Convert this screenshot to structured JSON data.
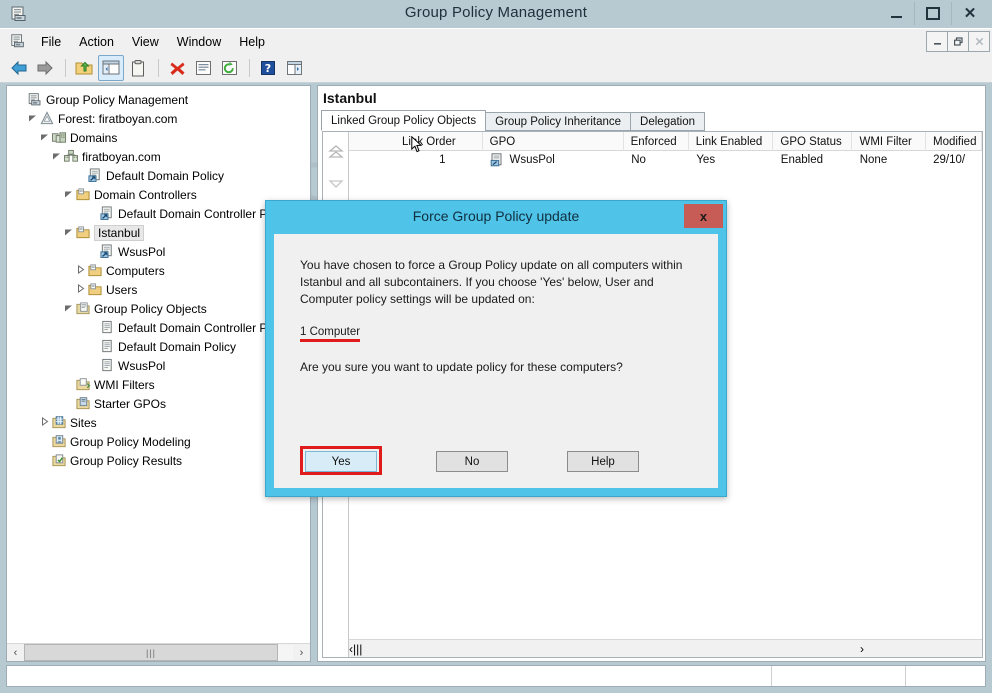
{
  "window": {
    "title": "Group Policy Management",
    "icon": "gpm-icon",
    "controls": {
      "minimize": "minimize-icon",
      "maximize": "maximize-icon",
      "close": "close-icon"
    }
  },
  "menu": {
    "items": [
      "File",
      "Action",
      "View",
      "Window",
      "Help"
    ],
    "mdi_controls": [
      "minimize",
      "restore",
      "close"
    ]
  },
  "toolbar": {
    "buttons": [
      {
        "name": "back-icon",
        "glyph": "back"
      },
      {
        "name": "forward-icon",
        "glyph": "forward"
      },
      {
        "name": "up-folder-icon",
        "glyph": "upfolder"
      },
      {
        "name": "show-hide-tree-icon",
        "glyph": "treepane",
        "selected": true
      },
      {
        "name": "properties-icon",
        "glyph": "clipboard"
      },
      {
        "name": "delete-icon",
        "glyph": "redx"
      },
      {
        "name": "report-icon",
        "glyph": "report"
      },
      {
        "name": "refresh-icon",
        "glyph": "refresh"
      },
      {
        "name": "help-icon",
        "glyph": "help"
      },
      {
        "name": "new-window-icon",
        "glyph": "newwindow"
      }
    ]
  },
  "tree": {
    "nodes": [
      {
        "label": "Group Policy Management",
        "indent": 0,
        "icon": "console-icon",
        "expander": ""
      },
      {
        "label": "Forest: firatboyan.com",
        "indent": 1,
        "icon": "forest-icon",
        "expander": "open"
      },
      {
        "label": "Domains",
        "indent": 2,
        "icon": "domains-icon",
        "expander": "open"
      },
      {
        "label": "firatboyan.com",
        "indent": 3,
        "icon": "domain-icon",
        "expander": "open"
      },
      {
        "label": "Default Domain Policy",
        "indent": 5,
        "icon": "gpo-link-icon",
        "expander": ""
      },
      {
        "label": "Domain Controllers",
        "indent": 4,
        "icon": "ou-icon",
        "expander": "open"
      },
      {
        "label": "Default Domain Controller Policy",
        "indent": 6,
        "icon": "gpo-link-icon",
        "expander": ""
      },
      {
        "label": "Istanbul",
        "indent": 4,
        "icon": "ou-icon",
        "expander": "open",
        "selected": true
      },
      {
        "label": "WsusPol",
        "indent": 6,
        "icon": "gpo-link-icon",
        "expander": ""
      },
      {
        "label": "Computers",
        "indent": 5,
        "icon": "ou-icon",
        "expander": "closed"
      },
      {
        "label": "Users",
        "indent": 5,
        "icon": "ou-icon",
        "expander": "closed"
      },
      {
        "label": "Group Policy Objects",
        "indent": 4,
        "icon": "gpo-container-icon",
        "expander": "open"
      },
      {
        "label": "Default Domain Controller Policy",
        "indent": 6,
        "icon": "gpo-icon",
        "expander": ""
      },
      {
        "label": "Default Domain Policy",
        "indent": 6,
        "icon": "gpo-icon",
        "expander": ""
      },
      {
        "label": "WsusPol",
        "indent": 6,
        "icon": "gpo-icon",
        "expander": ""
      },
      {
        "label": "WMI Filters",
        "indent": 4,
        "icon": "wmi-icon",
        "expander": ""
      },
      {
        "label": "Starter GPOs",
        "indent": 4,
        "icon": "starter-gpo-icon",
        "expander": ""
      },
      {
        "label": "Sites",
        "indent": 2,
        "icon": "sites-icon",
        "expander": "closed"
      },
      {
        "label": "Group Policy Modeling",
        "indent": 2,
        "icon": "modeling-icon",
        "expander": ""
      },
      {
        "label": "Group Policy Results",
        "indent": 2,
        "icon": "results-icon",
        "expander": ""
      }
    ],
    "scroll_thumb": "scroll-thumb"
  },
  "details": {
    "title": "Istanbul",
    "tabs": [
      {
        "label": "Linked Group Policy Objects",
        "active": true
      },
      {
        "label": "Group Policy Inheritance",
        "active": false
      },
      {
        "label": "Delegation",
        "active": false
      }
    ],
    "columns": [
      "Link Order",
      "GPO",
      "Enforced",
      "Link Enabled",
      "GPO Status",
      "WMI Filter",
      "Modified"
    ],
    "rows": [
      {
        "link_order": "1",
        "gpo": "WsusPol",
        "enforced": "No",
        "link_enabled": "Yes",
        "gpo_status": "Enabled",
        "wmi_filter": "None",
        "modified": "29/10/"
      }
    ]
  },
  "dialog": {
    "title": "Force Group Policy update",
    "close_label": "x",
    "paragraph": "You have chosen to force a Group Policy update on all computers within Istanbul and all subcontainers. If you choose 'Yes' below, User and Computer policy settings will be updated on:",
    "count": "1 Computer",
    "question": "Are you sure you want to update policy for these computers?",
    "buttons": [
      {
        "label": "Yes",
        "highlighted": true
      },
      {
        "label": "No",
        "highlighted": false
      },
      {
        "label": "Help",
        "highlighted": false
      }
    ]
  },
  "watermark": {
    "text": "firatboyan.com"
  },
  "colors": {
    "window_chrome": "#b7c9d1",
    "dialog_accent": "#4fc3e8",
    "highlight_red": "#e01b1b",
    "close_red": "#c75b55",
    "toolbar_bg": "#f0f0f0"
  }
}
